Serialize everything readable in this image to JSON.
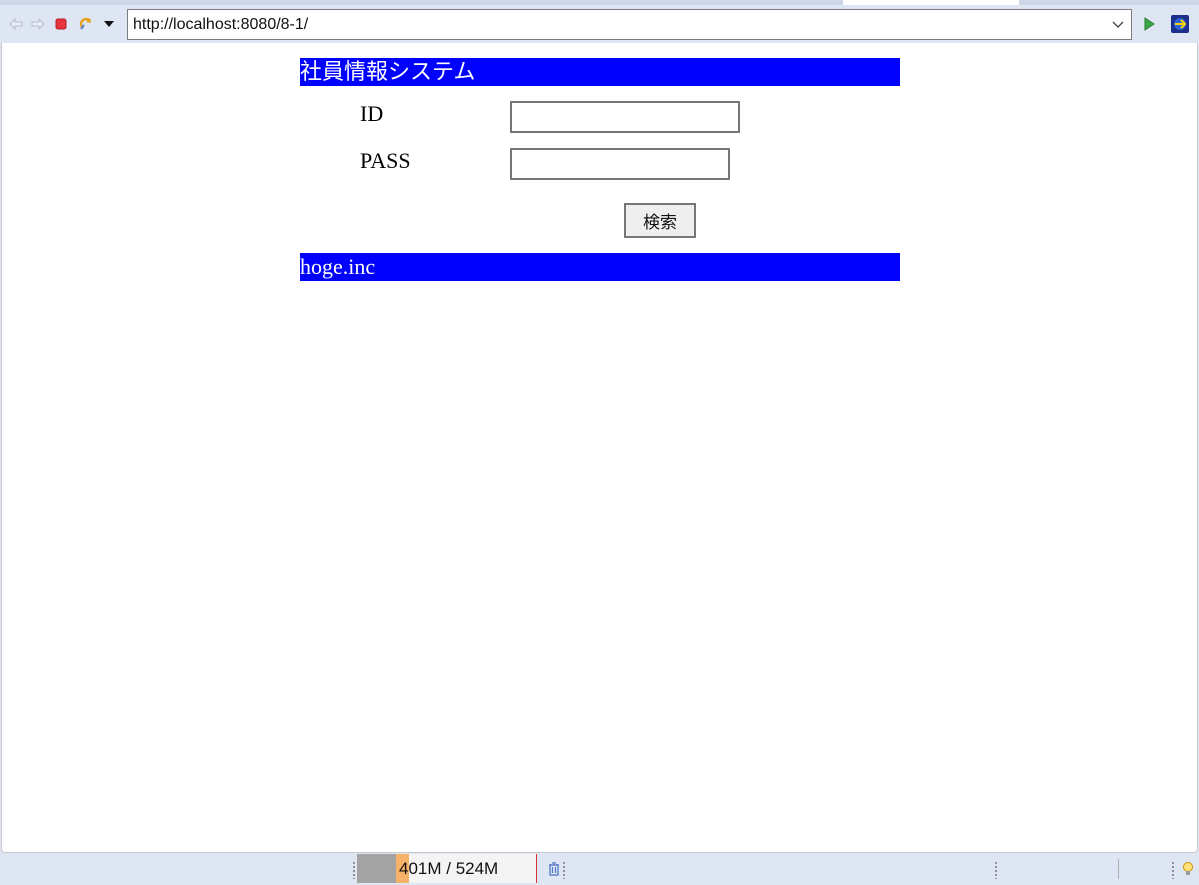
{
  "browser": {
    "url": "http://localhost:8080/8-1/",
    "icons": {
      "back": "back-arrow-icon",
      "forward": "forward-arrow-icon",
      "stop": "stop-icon",
      "refresh": "refresh-icon",
      "menu": "dropdown-menu-icon",
      "go": "go-icon",
      "open_external": "open-external-browser-icon"
    }
  },
  "page": {
    "header_title": "社員情報システム",
    "form": {
      "id_label": "ID",
      "id_value": "",
      "pass_label": "PASS",
      "pass_value": "",
      "submit_label": "検索"
    },
    "footer_text": "hoge.inc",
    "colors": {
      "bar_background": "#0000ff",
      "bar_text": "#ffffff"
    }
  },
  "status_bar": {
    "heap_text": "401M / 524M",
    "heap_used_fraction": 0.765,
    "gc_icon": "trash-icon",
    "tip_icon": "lightbulb-icon"
  }
}
